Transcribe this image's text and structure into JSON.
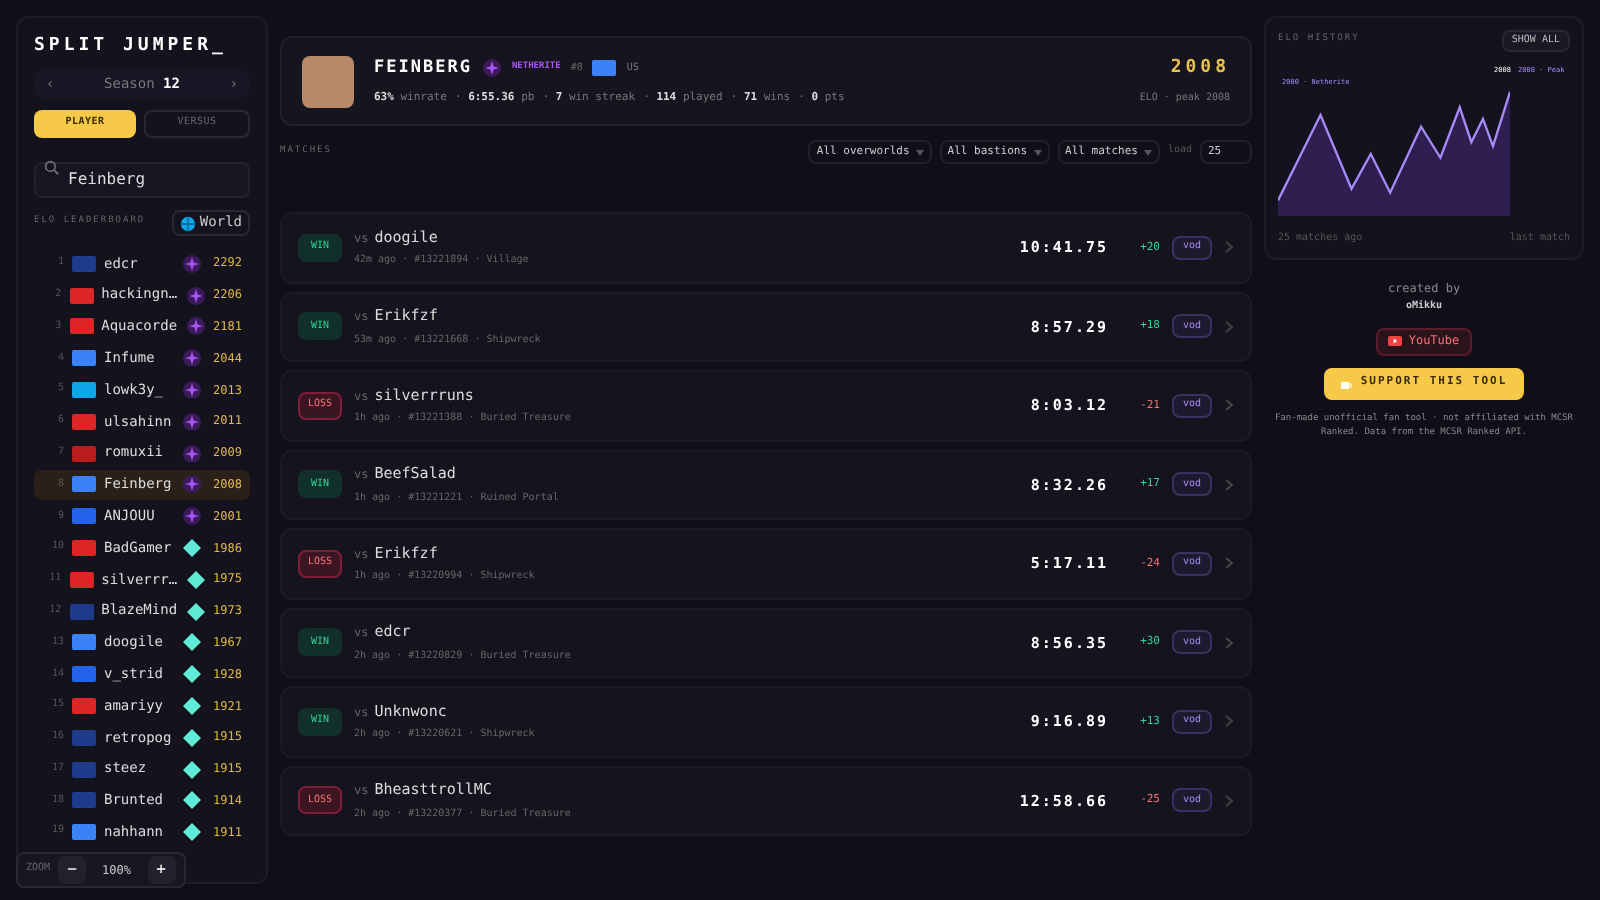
{
  "sidebar": {
    "logo": "SPLIT JUMPER_",
    "season": {
      "prev": "‹",
      "label": "Season",
      "value": "12",
      "next": "›"
    },
    "modes": [
      {
        "label": "PLAYER",
        "selected": true
      },
      {
        "label": "VERSUS",
        "selected": false
      }
    ],
    "search": {
      "value": "Feinberg"
    },
    "leaderboard_title": "ELO LEADERBOARD",
    "region": "World",
    "players": [
      {
        "rank": "1",
        "name": "edcr",
        "elo": "2292",
        "kind": "netherite",
        "color": "#1e3a8a",
        "selected": false
      },
      {
        "rank": "2",
        "name": "hackingn…",
        "elo": "2206",
        "kind": "netherite",
        "color": "#dc2626",
        "selected": false
      },
      {
        "rank": "3",
        "name": "Aquacorde",
        "elo": "2181",
        "kind": "netherite",
        "color": "#dc2626",
        "selected": false
      },
      {
        "rank": "4",
        "name": "Infume",
        "elo": "2044",
        "kind": "netherite",
        "color": "#3b82f6",
        "selected": false
      },
      {
        "rank": "5",
        "name": "lowk3y_",
        "elo": "2013",
        "kind": "netherite",
        "color": "#0ea5e9",
        "selected": false
      },
      {
        "rank": "6",
        "name": "ulsahinn",
        "elo": "2011",
        "kind": "netherite",
        "color": "#dc2626",
        "selected": false
      },
      {
        "rank": "7",
        "name": "romuxii",
        "elo": "2009",
        "kind": "netherite",
        "color": "#b91c1c",
        "selected": false
      },
      {
        "rank": "8",
        "name": "Feinberg",
        "elo": "2008",
        "kind": "netherite",
        "color": "#3b82f6",
        "selected": true
      },
      {
        "rank": "9",
        "name": "ANJOUU",
        "elo": "2001",
        "kind": "netherite",
        "color": "#2563eb",
        "selected": false
      },
      {
        "rank": "10",
        "name": "BadGamer",
        "elo": "1986",
        "kind": "diamond",
        "color": "#dc2626",
        "selected": false
      },
      {
        "rank": "11",
        "name": "silverrr…",
        "elo": "1975",
        "kind": "diamond",
        "color": "#dc2626",
        "selected": false
      },
      {
        "rank": "12",
        "name": "BlazeMind",
        "elo": "1973",
        "kind": "diamond",
        "color": "#1e3a8a",
        "selected": false
      },
      {
        "rank": "13",
        "name": "doogile",
        "elo": "1967",
        "kind": "diamond",
        "color": "#3b82f6",
        "selected": false
      },
      {
        "rank": "14",
        "name": "v_strid",
        "elo": "1928",
        "kind": "diamond",
        "color": "#2563eb",
        "selected": false
      },
      {
        "rank": "15",
        "name": "amariyy",
        "elo": "1921",
        "kind": "diamond",
        "color": "#dc2626",
        "selected": false
      },
      {
        "rank": "16",
        "name": "retropog",
        "elo": "1915",
        "kind": "diamond",
        "color": "#1e3a8a",
        "selected": false
      },
      {
        "rank": "17",
        "name": "steez",
        "elo": "1915",
        "kind": "diamond",
        "color": "#1e3a8a",
        "selected": false
      },
      {
        "rank": "18",
        "name": "Brunted",
        "elo": "1914",
        "kind": "diamond",
        "color": "#1e3a8a",
        "selected": false
      },
      {
        "rank": "19",
        "name": "nahhann",
        "elo": "1911",
        "kind": "diamond",
        "color": "#3b82f6",
        "selected": false
      }
    ]
  },
  "zoom": {
    "label": "ZOOM",
    "minus": "−",
    "value": "100%",
    "plus": "+"
  },
  "profile": {
    "name": "FEINBERG",
    "tier": "NETHERITE",
    "rank": "#8",
    "country": "US",
    "elo": "2008",
    "elo_caption": "ELO · peak 2008",
    "stats": [
      {
        "value": "63%",
        "label": "winrate"
      },
      {
        "sep": "·",
        "value": "6:55.36",
        "label": "pb"
      },
      {
        "sep": "·",
        "value": "7",
        "label": "win streak"
      },
      {
        "sep": "·",
        "value": "114",
        "label": "played"
      },
      {
        "sep": "·",
        "value": "71",
        "label": "wins"
      },
      {
        "sep": "·",
        "value": "0",
        "label": "pts"
      }
    ]
  },
  "matches": {
    "title": "MATCHES",
    "filters": [
      "All overworlds",
      "All bastions",
      "All matches"
    ],
    "load_label": "load",
    "load_value": "25",
    "rows": [
      {
        "kind": "win",
        "result": "WIN",
        "vs": "vs",
        "opponent": "doogile",
        "meta": "42m ago · #13221894 · Village",
        "time": "10:41.75",
        "delta": "+20",
        "vod": "vod"
      },
      {
        "kind": "win",
        "result": "WIN",
        "vs": "vs",
        "opponent": "Erikfzf",
        "meta": "53m ago · #13221668 · Shipwreck",
        "time": "8:57.29",
        "delta": "+18",
        "vod": "vod"
      },
      {
        "kind": "loss",
        "result": "LOSS",
        "vs": "vs",
        "opponent": "silverrruns",
        "meta": "1h ago · #13221388 · Buried Treasure",
        "time": "8:03.12",
        "delta": "-21",
        "vod": "vod"
      },
      {
        "kind": "win",
        "result": "WIN",
        "vs": "vs",
        "opponent": "BeefSalad",
        "meta": "1h ago · #13221221 · Ruined Portal",
        "time": "8:32.26",
        "delta": "+17",
        "vod": "vod"
      },
      {
        "kind": "loss",
        "result": "LOSS",
        "vs": "vs",
        "opponent": "Erikfzf",
        "meta": "1h ago · #13220994 · Shipwreck",
        "time": "5:17.11",
        "delta": "-24",
        "vod": "vod"
      },
      {
        "kind": "win",
        "result": "WIN",
        "vs": "vs",
        "opponent": "edcr",
        "meta": "2h ago · #13220829 · Buried Treasure",
        "time": "8:56.35",
        "delta": "+30",
        "vod": "vod"
      },
      {
        "kind": "win",
        "result": "WIN",
        "vs": "vs",
        "opponent": "Unknwonc",
        "meta": "2h ago · #13220621 · Shipwreck",
        "time": "9:16.89",
        "delta": "+13",
        "vod": "vod"
      },
      {
        "kind": "loss",
        "result": "LOSS",
        "vs": "vs",
        "opponent": "BheasttrollMC",
        "meta": "2h ago · #13220377 · Buried Treasure",
        "time": "12:58.66",
        "delta": "-25",
        "vod": "vod"
      }
    ]
  },
  "history": {
    "title": "ELO HISTORY",
    "show_all": "SHOW ALL",
    "threshold_label": "2000 · Netherite",
    "point_label": "2008",
    "peak_label": "2008 · Peak",
    "start_label": "25 matches ago",
    "end_label": "last match"
  },
  "credits": {
    "created_by": "created by",
    "author": "oMikku",
    "youtube": "YouTube",
    "support": "SUPPORT THIS TOOL",
    "disclaimer": "Fan-made unofficial fan tool · not affiliated with MCSR Ranked. Data from the MCSR Ranked API."
  }
}
